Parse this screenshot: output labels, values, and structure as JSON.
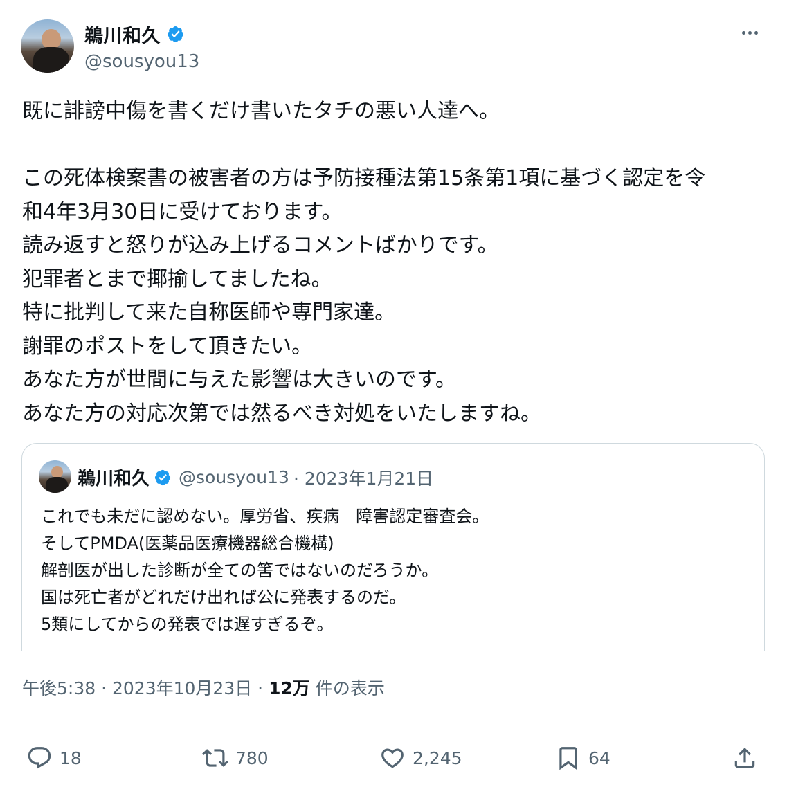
{
  "author": {
    "name": "鵜川和久",
    "handle": "@sousyou13"
  },
  "tweet": {
    "text": "既に誹謗中傷を書くだけ書いたタチの悪い人達へ。\n\nこの死体検案書の被害者の方は予防接種法第15条第1項に基づく認定を令\n和4年3月30日に受けております。\n読み返すと怒りが込み上げるコメントばかりです。\n犯罪者とまで揶揄してましたね。\n特に批判して来た自称医師や専門家達。\n謝罪のポストをして頂きたい。\nあなた方が世間に与えた影響は大きいのです。\nあなた方の対応次第では然るべき対処をいたしますね。"
  },
  "quote": {
    "name": "鵜川和久",
    "handle": "@sousyou13",
    "date": "· 2023年1月21日",
    "text": "これでも未だに認めない。厚労省、疾病　障害認定審査会。\nそしてPMDA(医薬品医療機器総合機構)\n解剖医が出した診断が全ての筈ではないのだろうか。\n国は死亡者がどれだけ出れば公に発表するのだ。\n5類にしてからの発表では遅すぎるぞ。"
  },
  "meta": {
    "timestamp": "午後5:38 · 2023年10月23日 · ",
    "views_count": "12万",
    "views_label": " 件の表示"
  },
  "actions": {
    "replies": "18",
    "reposts": "780",
    "likes": "2,245",
    "bookmarks": "64"
  },
  "colors": {
    "verified": "#1d9bf0",
    "secondary_text": "#536471",
    "border": "#cfd9de"
  },
  "icons": [
    "more-icon",
    "verified-badge-icon",
    "reply-icon",
    "repost-icon",
    "like-icon",
    "bookmark-icon",
    "share-icon"
  ]
}
